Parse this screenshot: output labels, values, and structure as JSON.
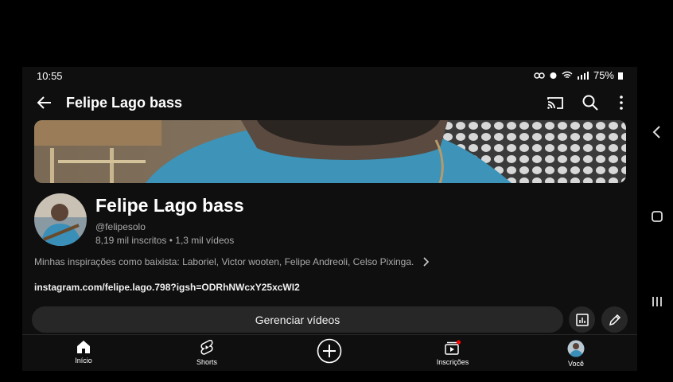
{
  "status": {
    "time": "10:55",
    "battery": "75%"
  },
  "appbar": {
    "title": "Felipe Lago bass"
  },
  "channel": {
    "name": "Felipe Lago bass",
    "handle": "@felipesolo",
    "subscribers": "8,19 mil inscritos",
    "separator": "•",
    "videos": "1,3 mil vídeos",
    "description": "Minhas inspirações como baixista: Laboriel, Victor wooten, Felipe Andreoli, Celso Pixinga.",
    "link": "instagram.com/felipe.lago.798?igsh=ODRhNWcxY25xcWI2"
  },
  "actions": {
    "manage_label": "Gerenciar vídeos"
  },
  "nav": {
    "items": [
      {
        "label": "Início",
        "icon": "home-icon"
      },
      {
        "label": "Shorts",
        "icon": "shorts-icon"
      },
      {
        "label": "",
        "icon": "create-icon"
      },
      {
        "label": "Inscrições",
        "icon": "subscriptions-icon"
      },
      {
        "label": "Você",
        "icon": "profile-avatar"
      }
    ]
  },
  "colors": {
    "background": "#0f0f0f",
    "button": "#272727",
    "secondary_text": "#aaaaaa",
    "notification_dot": "#ff0000"
  }
}
